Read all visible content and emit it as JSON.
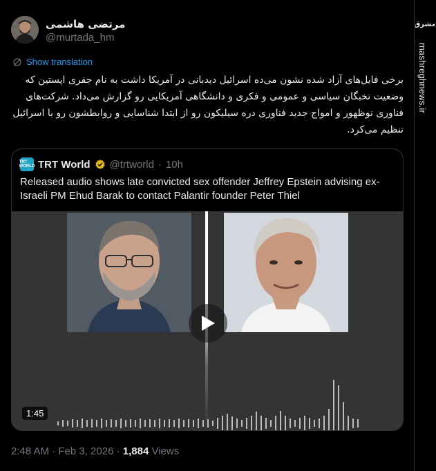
{
  "author": {
    "display_name": "مرتضی هاشمی",
    "handle": "@murtada_hm"
  },
  "translate_label": "Show translation",
  "tweet_text": "برخی فایل‌های آزاد شده نشون می‌ده اسرائیل دیدبانی در آمریکا داشت به نام جفری اپستین که وضعیت نخبگان سیاسی و عمومی و فکری و دانشگاهی آمریکایی رو گزارش می‌داد. شرکت‌های فناوری نوظهور و امواج جدید فناوری دره سیلیکون رو از ابتدا شناسایی و روابطشون رو با اسرائیل تنظیم می‌کرد.",
  "quote": {
    "logo_text": "TRT WORLD",
    "name": "TRT World",
    "handle": "@trtworld",
    "separator": "·",
    "time": "10h",
    "text": "Released audio shows late convicted sex offender Jeffrey Epstein advising ex-Israeli PM Ehud Barak to contact Palantir founder Peter Thiel",
    "duration": "1:45"
  },
  "footer": {
    "timestamp": "2:48 AM · Feb 3, 2026 · ",
    "views_count": "1,884",
    "views_label": " Views"
  },
  "watermark": {
    "logo_text": "مشرق",
    "domain": "mashreghnews.ir"
  },
  "colors": {
    "background": "#000000",
    "text": "#e7e9ea",
    "muted": "#71767b",
    "link": "#1d9bf0",
    "border": "#2f3336",
    "verified_gold": "#e2b719"
  },
  "icons": [
    "translate-icon",
    "verified-badge-icon",
    "play-icon"
  ]
}
